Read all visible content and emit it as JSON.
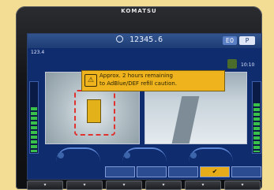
{
  "device": {
    "brand": "KOMATSU"
  },
  "status_bar": {
    "hour_meter": "12345.6",
    "eco_label": "E0",
    "mode_label": "P"
  },
  "gauges": {
    "left_label": "123.4",
    "right_label": "10:10",
    "left_level": 0.65,
    "right_level": 0.7
  },
  "caution": {
    "line1": "Approx. 2 hours remaining",
    "line2": "to AdBlue/DEF refill caution."
  },
  "function_keys": [
    "",
    "",
    "",
    "✔",
    ""
  ],
  "hardware_buttons": [
    "▾",
    "▾",
    "▾",
    "▾",
    "▾",
    "▾"
  ],
  "colors": {
    "caution": "#efb41d",
    "screen": "#0f2c6e",
    "active_key": "#e7ac1a"
  },
  "icons": {
    "warning": "warning-icon",
    "operator": "operator-icon",
    "clock": "clock-icon"
  }
}
